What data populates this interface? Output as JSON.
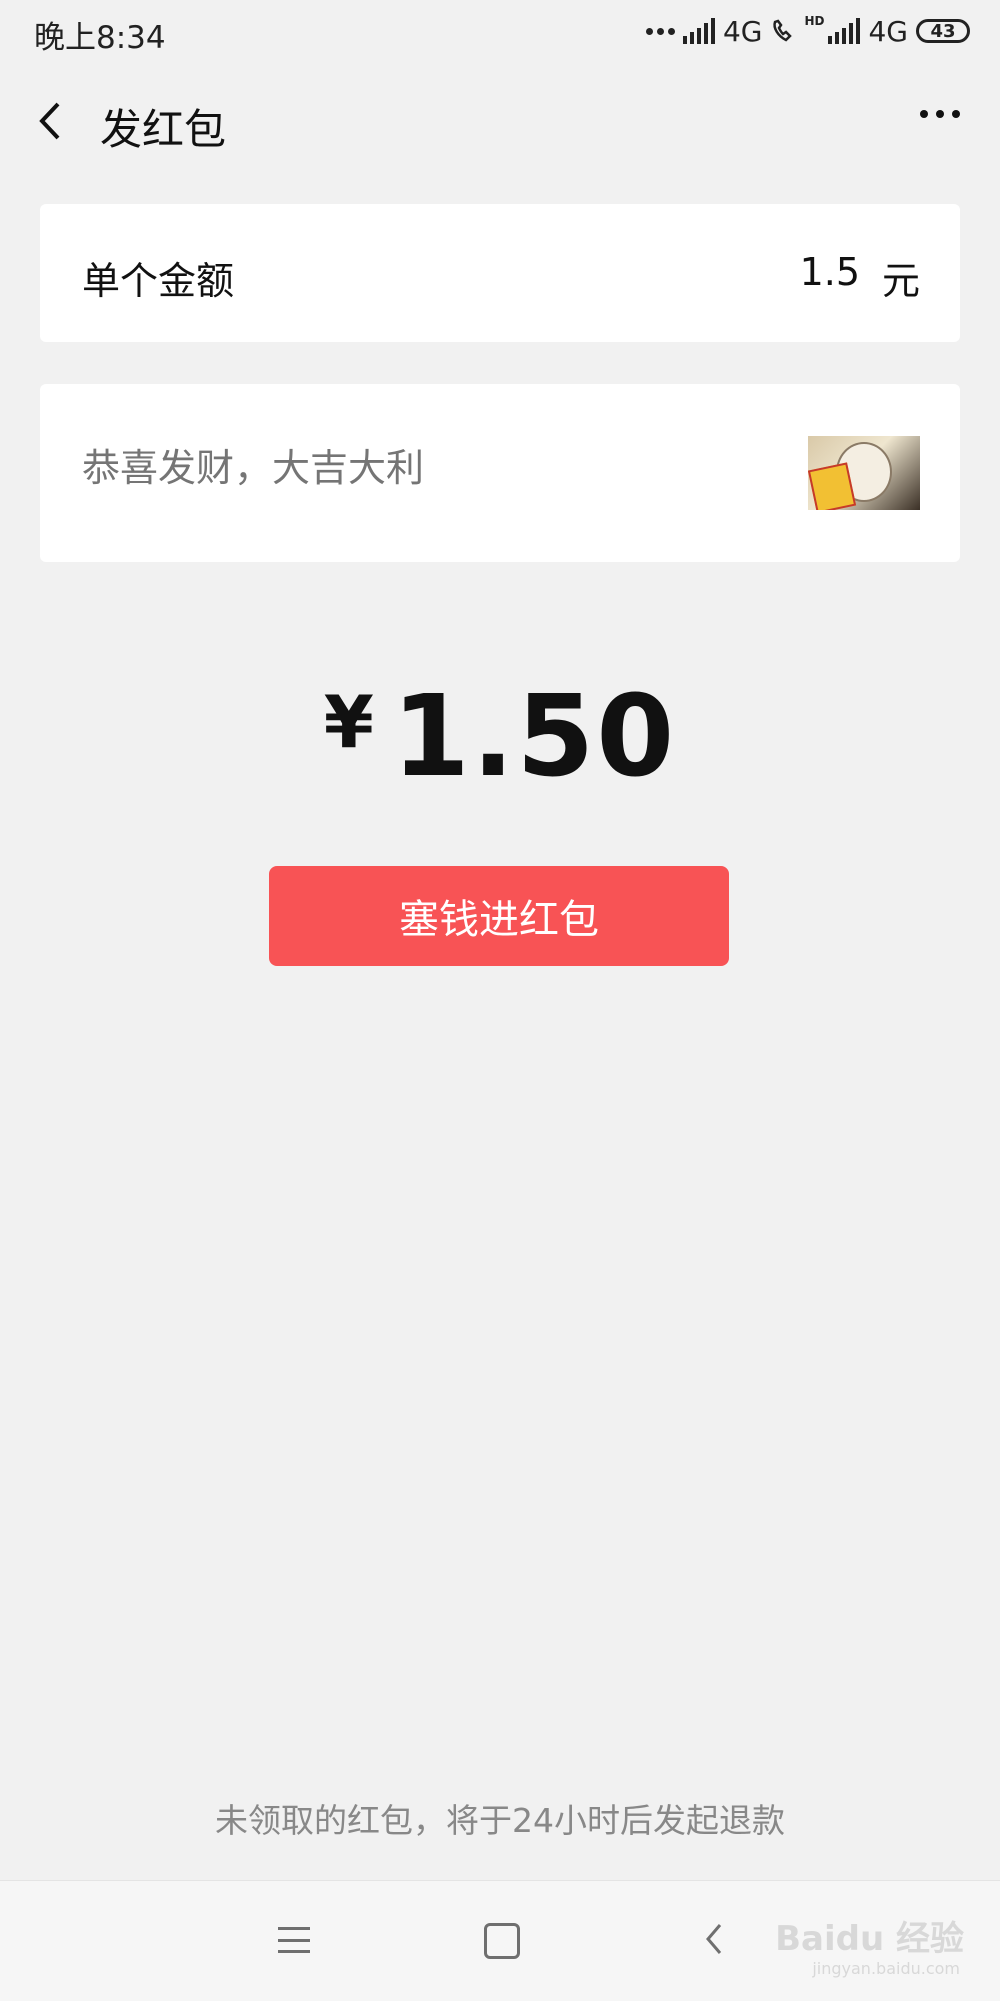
{
  "status_bar": {
    "time": "晚上8:34",
    "network_1": "4G",
    "network_2": "4G",
    "hd_label": "HD",
    "battery": "43"
  },
  "nav": {
    "title": "发红包"
  },
  "amount_row": {
    "label": "单个金额",
    "value": "1.5",
    "unit": "元"
  },
  "message_row": {
    "placeholder": "恭喜发财，大吉大利"
  },
  "total": {
    "currency": "¥",
    "amount": "1.50"
  },
  "send_button": {
    "label": "塞钱进红包"
  },
  "refund_note": "未领取的红包，将于24小时后发起退款",
  "watermark": {
    "text": "Baidu 经验",
    "sub": "jingyan.baidu.com"
  },
  "colors": {
    "accent": "#f85355",
    "background": "#f1f1f1"
  }
}
